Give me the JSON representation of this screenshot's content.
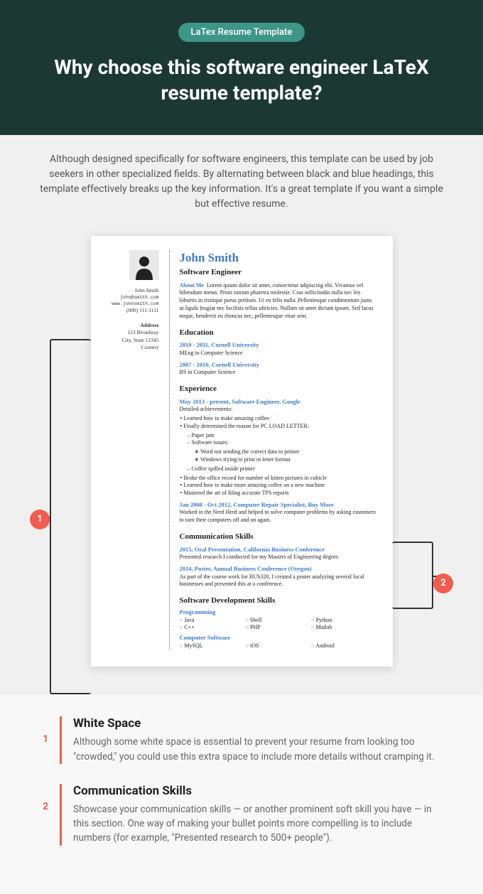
{
  "pill": "LaTex Resume Template",
  "title": "Why choose this software engineer LaTeX resume template?",
  "intro": "Although designed specifically for software engineers, this template can be used by job seekers in other specialized fields. By alternating between black and blue headings, this template effectively breaks up the key information. It's a great template if you want a simple but effective resume.",
  "markers": {
    "m1": "1",
    "m2": "2"
  },
  "side": {
    "name": "John Smith",
    "email": "john@smith.com",
    "web": "www.johnsmith.com",
    "phone": "(000) 111-1111",
    "addrHdr": "Address",
    "addr1": "123 Broadway",
    "addr2": "City, State 12345",
    "addr3": "Country"
  },
  "resume": {
    "name": "John Smith",
    "role": "Software Engineer",
    "aboutHdr": "About Me",
    "about": "Lorem ipsum dolor sit amet, consectetur adipiscing elit. Vivamus vel bibendum metus. Proin rutrum pharetra molestie. Cras sollicitudin nulla nec leo lobortis in tristique purus pretium. Ut eu felis nulla. Pellentesque condimentum justo ut ligula feugiat nec facilisis tellus ultricies. Nullam sit amet dictum ipsum. Sed lacus neque, hendrerit eu rhoncus nec, pellentesque vitae sem.",
    "eduHdr": "Education",
    "edu1a": "2010 - 2011, Cornell University",
    "edu1b": "MEng in Computer Science",
    "edu2a": "2007 - 2010, Cornell University",
    "edu2b": "BS in Computer Science",
    "expHdr": "Experience",
    "exp1a": "May 2013 - present, Software Engineer, Google",
    "exp1b": "Detailed achievements:",
    "b1": "Learned how to make amazing coffee",
    "b2": "Finally determined the reason for PC LOAD LETTER:",
    "b2a": "Paper jam",
    "b2b": "Software issues:",
    "b2b1": "Word not sending the correct data to printer",
    "b2b2": "Windows trying to print in letter format",
    "b2c": "Coffee spilled inside printer",
    "b3": "Broke the office record for number of kitten pictures in cubicle",
    "b4": "Learned how to make more amazing coffee on a new machine",
    "b5": "Mastered the art of filing accurate TPS reports",
    "exp2a": "Jan 2008 - Oct 2012, Computer Repair Specialist, Buy More",
    "exp2b": "Worked in the Nerd Herd and helped to solve computer problems by asking customers to turn their computers off and on again.",
    "commHdr": "Communication Skills",
    "c1a": "2015, Oral Presentation, California Business Conference",
    "c1b": "Presented research I conducted for my Masters of Engineering degree.",
    "c2a": "2014, Poster, Annual Business Conference (Oregon)",
    "c2b": "As part of the course work for BUS320, I created a poster analyzing several local businesses and presented this at a conference.",
    "devHdr": "Software Development Skills",
    "progHdr": "Programming",
    "s1": "Java",
    "s2": "Shell",
    "s3": "Python",
    "s4": "C++",
    "s5": "PHP",
    "s6": "Matlab",
    "swHdr": "Computer Software",
    "s7": "MySQL",
    "s8": "iOS",
    "s9": "Android"
  },
  "notes": [
    {
      "num": "1",
      "title": "White Space",
      "text": "Although some white space is essential to prevent your resume from looking too \"crowded,\" you could use this extra space to include more details without cramping it."
    },
    {
      "num": "2",
      "title": "Communication Skills",
      "text": "Showcase your communication skills — or another prominent soft skill you have — in this section. One way of making your bullet points more compelling is to include numbers (for example, \"Presented research to 500+ people\")."
    }
  ]
}
